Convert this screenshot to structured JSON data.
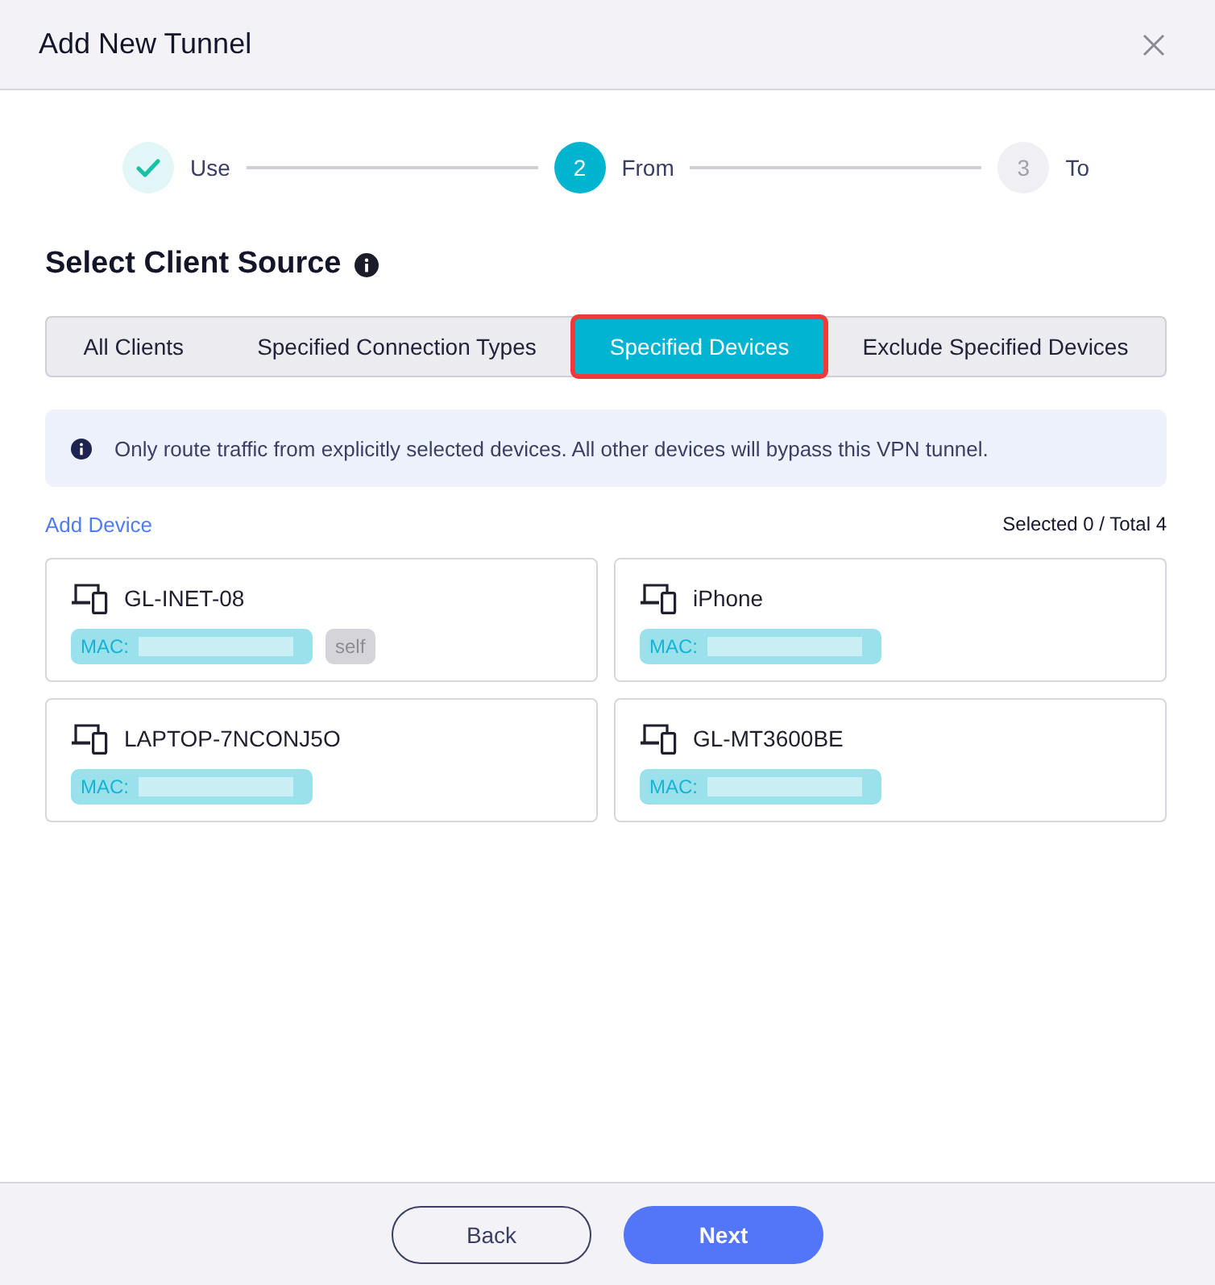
{
  "dialog": {
    "title": "Add New Tunnel"
  },
  "steps": [
    {
      "kind": "done",
      "label": "Use"
    },
    {
      "kind": "current",
      "number": "2",
      "label": "From"
    },
    {
      "kind": "upcoming",
      "number": "3",
      "label": "To"
    }
  ],
  "section": {
    "heading": "Select Client Source"
  },
  "tabs": [
    {
      "label": "All Clients",
      "selected": false,
      "highlighted": false
    },
    {
      "label": "Specified Connection Types",
      "selected": false,
      "highlighted": false
    },
    {
      "label": "Specified Devices",
      "selected": true,
      "highlighted": true
    },
    {
      "label": "Exclude Specified Devices",
      "selected": false,
      "highlighted": false
    }
  ],
  "notice": {
    "text": "Only route traffic from explicitly selected devices. All other devices will bypass this VPN tunnel."
  },
  "toolbar": {
    "add_link": "Add Device",
    "count": "Selected 0 / Total 4"
  },
  "devices": [
    {
      "name": "GL-INET-08",
      "mac_label": "MAC:",
      "mac_redacted": true,
      "tags": [
        "self"
      ]
    },
    {
      "name": "iPhone",
      "mac_label": "MAC:",
      "mac_redacted": true
    },
    {
      "name": "LAPTOP-7NCONJ5O",
      "mac_label": "MAC:",
      "mac_redacted": true
    },
    {
      "name": "GL-MT3600BE",
      "mac_label": "MAC:",
      "mac_redacted": true
    }
  ],
  "footer": {
    "buttons": [
      {
        "kind": "secondary",
        "label": "Back"
      },
      {
        "kind": "primary",
        "label": "Next"
      }
    ]
  }
}
